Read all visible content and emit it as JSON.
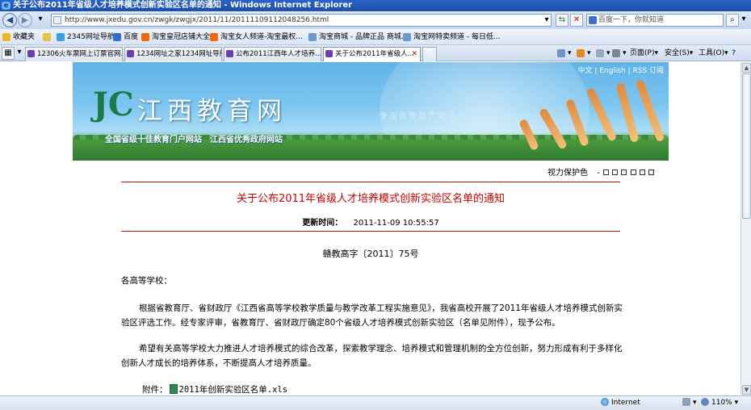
{
  "window": {
    "title": "关于公布2011年省级人才培养模式创新实验区名单的通知 - Windows Internet Explorer"
  },
  "address": {
    "url": "http://www.jxedu.gov.cn/zwgk/zwgjx/2011/11/20111109112048256.html"
  },
  "search": {
    "placeholder": "百度一下，你就知道"
  },
  "favorites": {
    "label": "收藏夹",
    "items": [
      "2345网址导航",
      "百度",
      "淘宝皇冠店铺大全",
      "淘宝女人频道-淘宝最权...",
      "淘宝商城 - 品牌正品 商城...",
      "淘宝网特卖频道 - 每日低..."
    ]
  },
  "tabs": [
    "12306火车票网上订票官网...",
    "1234网址之家1234网址导航",
    "公布2011江西年人才培养...",
    "关于公布2011年省级人..."
  ],
  "toolbar": {
    "page": "页面(P)",
    "safety": "安全(S)",
    "tools": "工具(O)",
    "help": "?"
  },
  "banner": {
    "langs": "中文 | English | RSS 订阅",
    "logo_mark": "JC",
    "logo_text": "江西教育网",
    "slogan": "争当优秀共产党员",
    "tagline": "全国省级十佳教育门户网站　江西省优秀政府网站"
  },
  "vision": {
    "label": "视力保护色"
  },
  "article": {
    "title": "关于公布2011年省级人才培养模式创新实验区名单的通知",
    "update_label": "更新时间：",
    "update_time": "2011-11-09 10:55:57",
    "doc_number": "赣教高字〔2011〕75号",
    "salutation": "各高等学校：",
    "para1": "根据省教育厅、省财政厅《江西省高等学校教学质量与教学改革工程实施意见》，我省高校开展了2011年省级人才培养模式创新实验区评选工作。经专家评审，省教育厅、省财政厅确定80个省级人才培养模式创新实验区（名单见附件），现予公布。",
    "para2": "希望有关高等学校大力推进人才培养模式的综合改革，探索教学理念、培养模式和管理机制的全方位创新，努力形成有利于多样化创新人才成长的培养体系，不断提高人才培养质量。",
    "attach_label": "附件：",
    "attach_file": "2011年创新实验区名单.xls"
  },
  "status": {
    "zone": "Internet",
    "zoom": "110%"
  }
}
